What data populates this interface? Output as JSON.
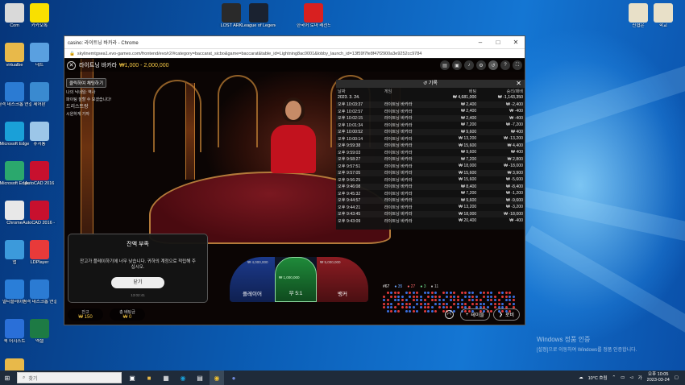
{
  "desktop_icons_left": [
    {
      "label": "Com",
      "icon": "computer-icon",
      "color": "#d9d9d9"
    },
    {
      "label": "카카오톡",
      "icon": "kakaotalk-icon",
      "color": "#f9e000"
    },
    {
      "label": "virtualbe",
      "icon": "folder-icon",
      "color": "#e8b94a"
    },
    {
      "label": "네트",
      "icon": "network-icon",
      "color": "#5aa0e0"
    },
    {
      "label": "원격 데스크톱 연결",
      "icon": "remote-desktop-icon",
      "color": "#2b7bd3"
    },
    {
      "label": "제어판",
      "icon": "control-panel-icon",
      "color": "#3a8ad0"
    },
    {
      "label": "Microsoft Edge",
      "icon": "edge-icon",
      "color": "#1aa0d8"
    },
    {
      "label": "휴지통",
      "icon": "recycle-bin-icon",
      "color": "#9cc6e8"
    },
    {
      "label": "Microsoft Edge",
      "icon": "edge-icon",
      "color": "#2ba86d"
    },
    {
      "label": "AutoCAD 2016",
      "icon": "autocad-icon",
      "color": "#c8102e"
    },
    {
      "label": "Chrome",
      "icon": "chrome-icon",
      "color": "#e8e8e8"
    },
    {
      "label": "AutoCAD 2016 - 한",
      "icon": "autocad-icon",
      "color": "#c8102e"
    },
    {
      "label": "앱",
      "icon": "apps-icon",
      "color": "#3c9adb"
    },
    {
      "label": "LDPlayer",
      "icon": "ldplayer-icon",
      "color": "#e83a3a"
    },
    {
      "label": "멀티플레이어",
      "icon": "multiplayer-icon",
      "color": "#2a7ed8"
    },
    {
      "label": "원격 데스크톱 연결",
      "icon": "remote-desktop-icon",
      "color": "#2b7bd3"
    },
    {
      "label": "퀵 어시스트",
      "icon": "quick-assist-icon",
      "color": "#2a6fd8"
    },
    {
      "label": "엑셀",
      "icon": "excel-icon",
      "color": "#1d7a44"
    },
    {
      "label": "Photos",
      "icon": "folder-icon",
      "color": "#e8b94a"
    }
  ],
  "desktop_icons_top": [
    {
      "label": "LOST ARK",
      "icon": "lost-ark-icon",
      "color": "#2a2a2a"
    },
    {
      "label": "League of Legends",
      "icon": "league-icon",
      "color": "#1a2230"
    },
    {
      "label": "한국어 로마 레전드",
      "icon": "roblox-icon",
      "color": "#d82020"
    }
  ],
  "desktop_icons_right": [
    {
      "label": "신협은",
      "icon": "file-icon",
      "color": "#e8e0c8"
    },
    {
      "label": "학교",
      "icon": "file-icon",
      "color": "#e8e0c8"
    }
  ],
  "browser": {
    "title": "casino: 라이트닝 바카라 - Chrome",
    "url": "skylinemtgsea1.evo-games.com/frontend/evo/r2/#category=baccarat_sicbo&game=baccarat&table_id=Lightning8ac0001&lobby_launch_id=13f59f7fe8f47f2900a3e9252cc9784",
    "controls": {
      "minimize": "–",
      "maximize": "□",
      "close": "✕"
    }
  },
  "game": {
    "name": "라이트닝 바카라",
    "bet_limits": "₩1,000 - 2,000,000",
    "chat_button": "클릭하여 채팅하기",
    "chat_lines": [
      "나의 닉네임: 역사",
      "파이팅 잘할 수 보겠습니다!",
      "드리스트랑",
      "시원하게 가자"
    ],
    "balance_label": "잔고",
    "balance_value": "₩ 150",
    "total_bet_label": "총 배팅금",
    "total_bet_value": "₩ 0",
    "bet_zones": {
      "player": "플레이어",
      "tie": "무 5:1",
      "banker": "뱅커"
    },
    "stat_left": "₩ 4,000,000",
    "stat_mid": "₩ 5,000,000",
    "stat_tie": "₩ 1,000,000",
    "road_counts": [
      "67",
      "35",
      "27",
      "3",
      "11"
    ],
    "bottom_buttons": {
      "tables": "테이블",
      "lobby": "로비"
    }
  },
  "modal": {
    "title": "잔액 부족",
    "message": "잔고가 플레이하기에 너무 낮습니다. 귀하의 계정으로 적립해 주십시오.",
    "button": "닫기",
    "time": "13:02:41"
  },
  "history": {
    "title": "기록",
    "columns": [
      "날짜",
      "게임",
      "배팅",
      "승리/패배"
    ],
    "summary": {
      "date": "2023. 3. 24.",
      "bet": "₩ 4,681,000",
      "result": "₩ -1,143,350"
    },
    "rows": [
      [
        "오후 10:03:37",
        "라이트닝 바카라",
        "₩ 2,400",
        "₩ -2,400"
      ],
      [
        "오후 10:02:57",
        "라이트닝 바카라",
        "₩ 2,400",
        "₩ -400"
      ],
      [
        "오후 10:02:15",
        "라이트닝 바카라",
        "₩ 2,400",
        "₩ -400"
      ],
      [
        "오후 10:01:34",
        "라이트닝 바카라",
        "₩ 7,200",
        "₩ -7,200"
      ],
      [
        "오후 10:00:52",
        "라이트닝 바카라",
        "₩ 9,600",
        "₩ 400"
      ],
      [
        "오후 10:00:14",
        "라이트닝 바카라",
        "₩ 13,200",
        "₩ -13,200"
      ],
      [
        "오후 9:59:38",
        "라이트닝 바카라",
        "₩ 15,600",
        "₩ 4,400"
      ],
      [
        "오후 9:59:03",
        "라이트닝 바카라",
        "₩ 9,600",
        "₩ 400"
      ],
      [
        "오후 9:58:27",
        "라이트닝 바카라",
        "₩ 7,200",
        "₩ 2,800"
      ],
      [
        "오후 9:57:51",
        "라이트닝 바카라",
        "₩ 18,000",
        "₩ -18,000"
      ],
      [
        "오후 9:57:05",
        "라이트닝 바카라",
        "₩ 15,600",
        "₩ 3,900"
      ],
      [
        "오후 9:56:25",
        "라이트닝 바카라",
        "₩ 15,600",
        "₩ -5,600"
      ],
      [
        "오후 9:46:08",
        "라이트닝 바카라",
        "₩ 8,400",
        "₩ -8,400"
      ],
      [
        "오후 9:45:32",
        "라이트닝 바카라",
        "₩ 7,200",
        "₩ -1,200"
      ],
      [
        "오후 9:44:57",
        "라이트닝 바카라",
        "₩ 9,600",
        "₩ -9,600"
      ],
      [
        "오후 9:44:21",
        "라이트닝 바카라",
        "₩ 13,200",
        "₩ -3,200"
      ],
      [
        "오후 9:43:45",
        "라이트닝 바카라",
        "₩ 18,000",
        "₩ -18,000"
      ],
      [
        "오후 9:43:09",
        "라이트닝 바카라",
        "₩ 20,400",
        "₩ -400"
      ]
    ]
  },
  "watermark": {
    "line1": "Windows 정품 인증",
    "line2": "[설정]으로 이동하여 Windows를 정품 인증합니다."
  },
  "taskbar": {
    "search_placeholder": "찾기",
    "weather": "10°C 흐림",
    "time": "오후 10:05",
    "date": "2023-03-24"
  },
  "colors": {
    "accent_gold": "#f6c945",
    "player_blue": "#1c3a8c",
    "banker_red": "#8c1c22",
    "tie_green": "#1f8a3a"
  }
}
